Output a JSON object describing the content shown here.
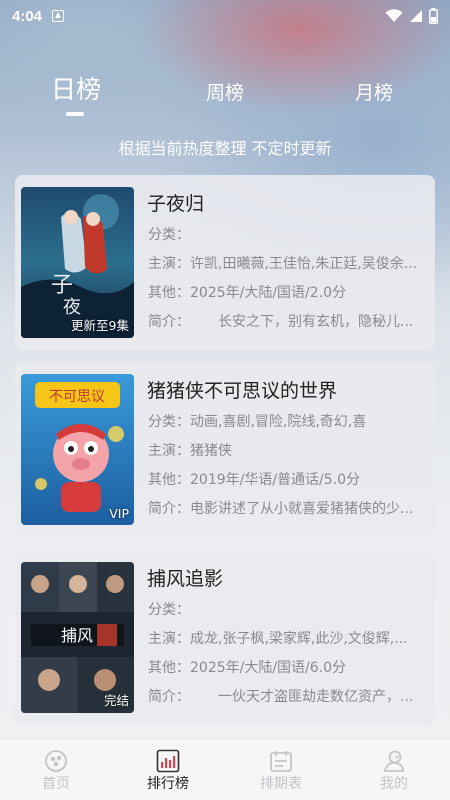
{
  "status_bar": {
    "time": "4:04",
    "icons": [
      "app-notification-icon",
      "wifi-icon",
      "signal-icon",
      "battery-icon"
    ]
  },
  "tabs": [
    {
      "label": "日榜",
      "active": true
    },
    {
      "label": "周榜",
      "active": false
    },
    {
      "label": "月榜",
      "active": false
    }
  ],
  "subtitle": "根据当前热度整理 不定时更新",
  "cards": [
    {
      "title": "子夜归",
      "badge": "更新至9集",
      "category_label": "分类：",
      "category": "",
      "cast_label": "主演：",
      "cast": "许凯,田曦薇,王佳怡,朱正廷,吴俊余...",
      "other_label": "其他：",
      "other": "2025年/大陆/国语/2.0分",
      "intro_label": "简介：",
      "intro": "　　长安之下，别有玄机，隐秘儿..."
    },
    {
      "title": "猪猪侠不可思议的世界",
      "badge": "VIP",
      "category_label": "分类：",
      "category": "动画,喜剧,冒险,院线,奇幻,喜",
      "cast_label": "主演：",
      "cast": "猪猪侠",
      "other_label": "其他：",
      "other": "2019年/华语/普通话/5.0分",
      "intro_label": "简介：",
      "intro": "电影讲述了从小就喜爱猪猪侠的少..."
    },
    {
      "title": "捕风追影",
      "badge": "完结",
      "category_label": "分类：",
      "category": "",
      "cast_label": "主演：",
      "cast": "成龙,张子枫,梁家辉,此沙,文俊辉,...",
      "other_label": "其他：",
      "other": "2025年/大陆/国语/6.0分",
      "intro_label": "简介：",
      "intro": "　　一伙天才盗匪劫走数亿资产，..."
    }
  ],
  "bottom_nav": [
    {
      "label": "首页",
      "icon": "home-icon",
      "active": false
    },
    {
      "label": "排行榜",
      "icon": "ranking-icon",
      "active": true
    },
    {
      "label": "排期表",
      "icon": "calendar-icon",
      "active": false
    },
    {
      "label": "我的",
      "icon": "profile-icon",
      "active": false
    }
  ],
  "colors": {
    "card_bg": "#e9eaee",
    "title_text": "#222222",
    "meta_text": "#8a8a8e",
    "nav_inactive": "#c4c4c8"
  }
}
